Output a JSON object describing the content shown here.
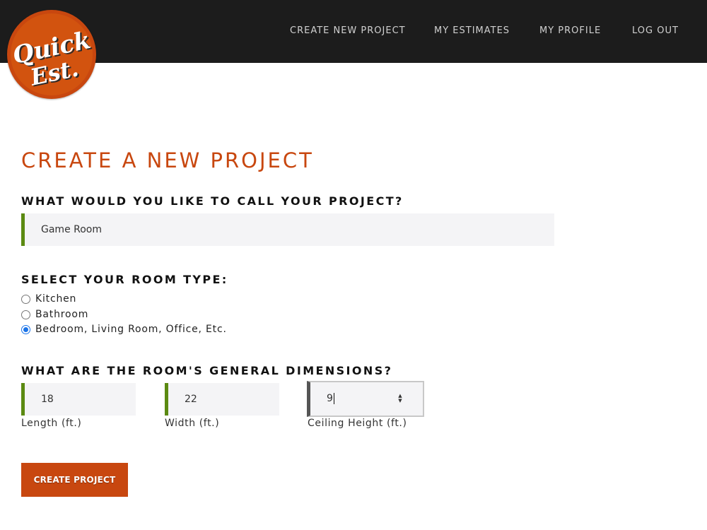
{
  "brand": {
    "logo_line1": "Quick",
    "logo_line2": "Est.",
    "accent_color": "#c8470f",
    "field_accent_color": "#5b8a12"
  },
  "nav": {
    "create_new_project": "CREATE NEW PROJECT",
    "my_estimates": "MY ESTIMATES",
    "my_profile": "MY PROFILE",
    "log_out": "LOG OUT"
  },
  "page": {
    "title": "CREATE A NEW PROJECT"
  },
  "project_name": {
    "question": "WHAT WOULD YOU LIKE TO CALL YOUR PROJECT?",
    "value": "Game Room"
  },
  "room_type": {
    "question": "SELECT YOUR ROOM TYPE:",
    "options": [
      {
        "label": "Kitchen",
        "checked": false
      },
      {
        "label": "Bathroom",
        "checked": false
      },
      {
        "label": "Bedroom, Living Room, Office, Etc.",
        "checked": true
      }
    ]
  },
  "dimensions": {
    "question": "WHAT ARE THE ROOM'S GENERAL DIMENSIONS?",
    "length": {
      "value": "18",
      "caption": "Length (ft.)"
    },
    "width": {
      "value": "22",
      "caption": "Width (ft.)"
    },
    "ceiling_height": {
      "value": "9",
      "caption": "Ceiling Height (ft.)",
      "focused": true
    }
  },
  "submit": {
    "label": "CREATE PROJECT"
  }
}
